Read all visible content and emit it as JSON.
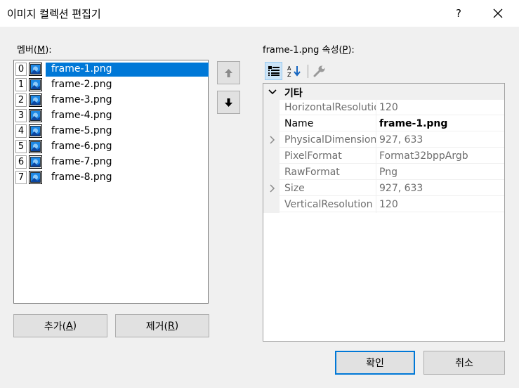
{
  "window": {
    "title": "이미지 컬렉션 편집기",
    "help_label": "?"
  },
  "members": {
    "label_prefix": "멤버(",
    "label_accel": "M",
    "label_suffix": "):",
    "items": [
      {
        "index": "0",
        "name": "frame-1.png"
      },
      {
        "index": "1",
        "name": "frame-2.png"
      },
      {
        "index": "2",
        "name": "frame-3.png"
      },
      {
        "index": "3",
        "name": "frame-4.png"
      },
      {
        "index": "4",
        "name": "frame-5.png"
      },
      {
        "index": "5",
        "name": "frame-6.png"
      },
      {
        "index": "6",
        "name": "frame-7.png"
      },
      {
        "index": "7",
        "name": "frame-8.png"
      }
    ],
    "selected_index": 0,
    "add_prefix": "추가(",
    "add_accel": "A",
    "add_suffix": ")",
    "remove_prefix": "제거(",
    "remove_accel": "R",
    "remove_suffix": ")"
  },
  "properties": {
    "label_prefix": "frame-1.png 속성(",
    "label_accel": "P",
    "label_suffix": "):",
    "category": "기타",
    "rows": [
      {
        "name": "HorizontalResolution",
        "value": "120"
      },
      {
        "name": "Name",
        "value": "frame-1.png"
      },
      {
        "name": "PhysicalDimension",
        "value": "927, 633"
      },
      {
        "name": "PixelFormat",
        "value": "Format32bppArgb"
      },
      {
        "name": "RawFormat",
        "value": "Png"
      },
      {
        "name": "Size",
        "value": "927, 633"
      },
      {
        "name": "VerticalResolution",
        "value": "120"
      }
    ]
  },
  "footer": {
    "ok_label": "확인",
    "cancel_label": "취소"
  },
  "colors": {
    "selection": "#0078d7",
    "window_bg": "#f0f0f0"
  }
}
